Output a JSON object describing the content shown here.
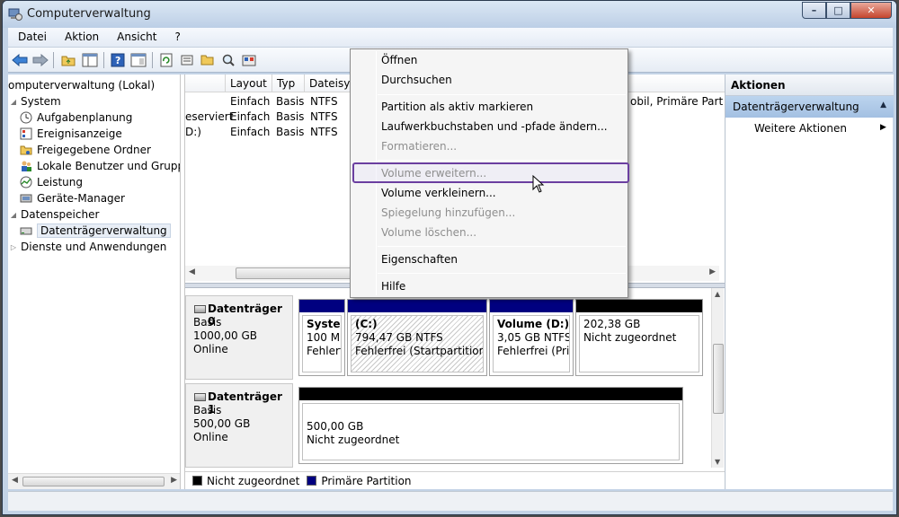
{
  "window": {
    "title": "Computerverwaltung",
    "buttons": {
      "minimize": "–",
      "maximize": "□",
      "close": "✕"
    }
  },
  "menu": [
    "Datei",
    "Aktion",
    "Ansicht",
    "?"
  ],
  "toolbar": {
    "icons": [
      "back-icon",
      "forward-icon",
      "up-folder-icon",
      "show-tree-icon",
      "help-icon",
      "properties-icon",
      "refresh-icon",
      "settings-icon",
      "open-folder-icon",
      "search-icon",
      "find-icon"
    ]
  },
  "tree": {
    "items": [
      {
        "label": "omputerverwaltung (Lokal)",
        "icon": "computer-icon"
      },
      {
        "label": "System",
        "icon": ""
      },
      {
        "label": "Aufgabenplanung",
        "icon": "clock-icon"
      },
      {
        "label": "Ereignisanzeige",
        "icon": "event-viewer-icon"
      },
      {
        "label": "Freigegebene Ordner",
        "icon": "shared-folder-icon"
      },
      {
        "label": "Lokale Benutzer und Gruppen",
        "icon": "users-icon"
      },
      {
        "label": "Leistung",
        "icon": "performance-icon"
      },
      {
        "label": "Geräte-Manager",
        "icon": "device-manager-icon"
      },
      {
        "label": "Datenspeicher",
        "icon": ""
      },
      {
        "label": "Datenträgerverwaltung",
        "icon": "disk-management-icon"
      },
      {
        "label": "Dienste und Anwendungen",
        "icon": ""
      }
    ]
  },
  "list": {
    "columns": [
      "Layout",
      "Typ",
      "Dateisyst",
      "obil, Primäre Part"
    ],
    "rows": [
      {
        "name": "",
        "layout": "Einfach",
        "typ": "Basis",
        "fs": "NTFS",
        "status": "obil, Primäre Part"
      },
      {
        "name": "eserviert",
        "layout": "Einfach",
        "typ": "Basis",
        "fs": "NTFS",
        "status": ""
      },
      {
        "name": "D:)",
        "layout": "Einfach",
        "typ": "Basis",
        "fs": "NTFS",
        "status": ""
      }
    ]
  },
  "disks": [
    {
      "title": "Datenträger 0",
      "type": "Basis",
      "size": "1000,00 GB",
      "state": "Online",
      "partitions": [
        {
          "name": "Systen",
          "size": "100 MB",
          "status": "Fehlerfr"
        },
        {
          "name": "(C:)",
          "size": "794,47 GB NTFS",
          "status": "Fehlerfrei (Startpartition, Au"
        },
        {
          "name": "Volume  (D:)",
          "size": "3,05 GB NTFS",
          "status": "Fehlerfrei (Prim"
        },
        {
          "name": "",
          "size": "202,38 GB",
          "status": "Nicht zugeordnet"
        }
      ]
    },
    {
      "title": "Datenträger 1",
      "type": "Basis",
      "size": "500,00 GB",
      "state": "Online",
      "partitions": [
        {
          "name": "",
          "size": "500,00 GB",
          "status": "Nicht zugeordnet"
        }
      ]
    }
  ],
  "legend": [
    {
      "label": "Nicht zugeordnet",
      "color": "#000000"
    },
    {
      "label": "Primäre Partition",
      "color": "#000080"
    }
  ],
  "actions": {
    "header": "Aktionen",
    "section": "Datenträgerverwaltung",
    "item": "Weitere Aktionen"
  },
  "context_menu": {
    "items": [
      {
        "label": "Öffnen",
        "enabled": true
      },
      {
        "label": "Durchsuchen",
        "enabled": true
      },
      {
        "label": "Partition als aktiv markieren",
        "enabled": true
      },
      {
        "label": "Laufwerkbuchstaben und -pfade ändern...",
        "enabled": true
      },
      {
        "label": "Formatieren...",
        "enabled": false
      },
      {
        "label": "Volume erweitern...",
        "enabled": false
      },
      {
        "label": "Volume verkleinern...",
        "enabled": true
      },
      {
        "label": "Spiegelung hinzufügen...",
        "enabled": false
      },
      {
        "label": "Volume löschen...",
        "enabled": false
      },
      {
        "label": "Eigenschaften",
        "enabled": true
      },
      {
        "label": "Hilfe",
        "enabled": true
      }
    ],
    "highlighted": "Volume erweitern..."
  },
  "colors": {
    "primary_partition": "#000080",
    "unallocated": "#000000",
    "highlight": "#6b3fa0",
    "title_bar": "#c3d3e6"
  }
}
